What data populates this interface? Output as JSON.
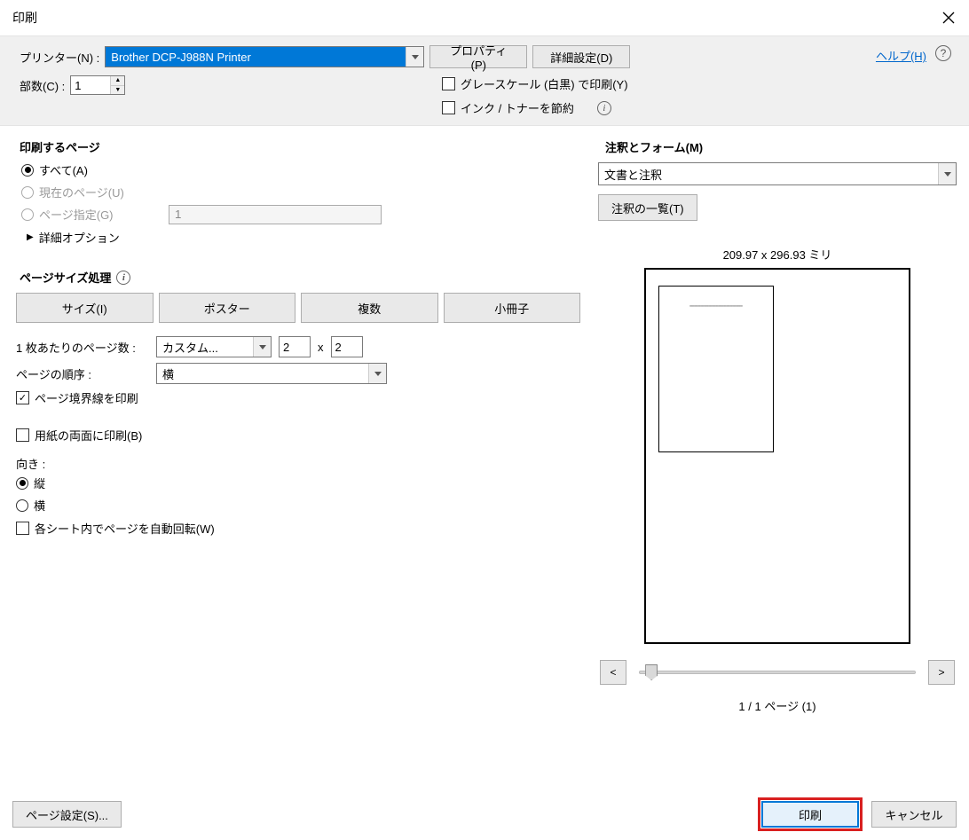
{
  "titlebar": {
    "title": "印刷"
  },
  "header": {
    "printer_label": "プリンター(N) :",
    "printer_value": "Brother DCP-J988N Printer",
    "properties_btn": "プロパティ(P)",
    "advanced_btn": "詳細設定(D)",
    "help_link": "ヘルプ(H)",
    "copies_label": "部数(C) :",
    "copies_value": "1",
    "grayscale_label": "グレースケール (白黒) で印刷(Y)",
    "save_ink_label": "インク / トナーを節約"
  },
  "pages_section": {
    "title": "印刷するページ",
    "all": "すべて(A)",
    "current": "現在のページ(U)",
    "pages_spec": "ページ指定(G)",
    "pages_spec_value": "1",
    "more_options": "詳細オプション"
  },
  "size_section": {
    "title": "ページサイズ処理",
    "tabs": {
      "size": "サイズ(I)",
      "poster": "ポスター",
      "multiple": "複数",
      "booklet": "小冊子"
    },
    "pages_per_sheet_label": "1 枚あたりのページ数 :",
    "pages_per_sheet_value": "カスタム...",
    "pps_x": "2",
    "pps_x_sep": "x",
    "pps_y": "2",
    "page_order_label": "ページの順序 :",
    "page_order_value": "横",
    "print_border_label": "ページ境界線を印刷",
    "duplex_label": "用紙の両面に印刷(B)",
    "orientation_label": "向き :",
    "portrait": "縦",
    "landscape": "横",
    "auto_rotate": "各シート内でページを自動回転(W)"
  },
  "comments_section": {
    "title": "注釈とフォーム(M)",
    "select_value": "文書と注釈",
    "list_btn": "注釈の一覧(T)"
  },
  "preview": {
    "dimensions": "209.97 x 296.93 ミリ",
    "prev": "<",
    "next": ">",
    "page_indicator": "1 / 1 ページ (1)"
  },
  "footer": {
    "page_setup": "ページ設定(S)...",
    "print": "印刷",
    "cancel": "キャンセル"
  }
}
